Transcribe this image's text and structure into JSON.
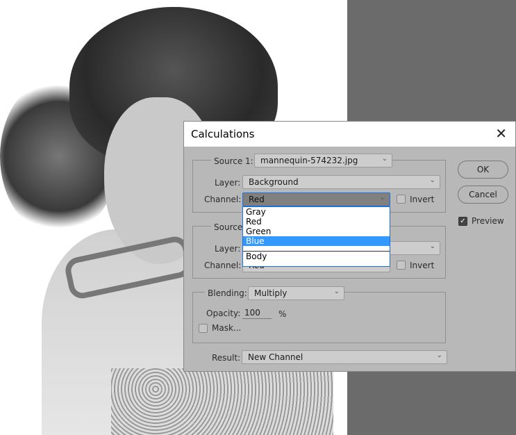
{
  "dialog": {
    "title": "Calculations",
    "close_icon": "close-icon"
  },
  "source1": {
    "label": "Source 1:",
    "file": "mannequin-574232.jpg",
    "layer_label": "Layer:",
    "layer": "Background",
    "channel_label": "Channel:",
    "channel": "Red",
    "invert_label": "Invert",
    "invert": false
  },
  "channel_dropdown": {
    "options": [
      "Gray",
      "Red",
      "Green",
      "Blue",
      "Body"
    ],
    "highlighted": "Blue",
    "highlight_color": "#3399ff"
  },
  "source2": {
    "label": "Source",
    "layer_label": "Layer:",
    "channel_label": "Channel:",
    "channel": "Red",
    "invert_label": "Invert",
    "invert": false
  },
  "blending": {
    "label": "Blending:",
    "mode": "Multiply",
    "opacity_label": "Opacity:",
    "opacity": "100",
    "percent": "%",
    "mask_label": "Mask...",
    "mask": false
  },
  "result": {
    "label": "Result:",
    "value": "New Channel"
  },
  "buttons": {
    "ok": "OK",
    "cancel": "Cancel"
  },
  "preview": {
    "label": "Preview",
    "checked": true
  }
}
